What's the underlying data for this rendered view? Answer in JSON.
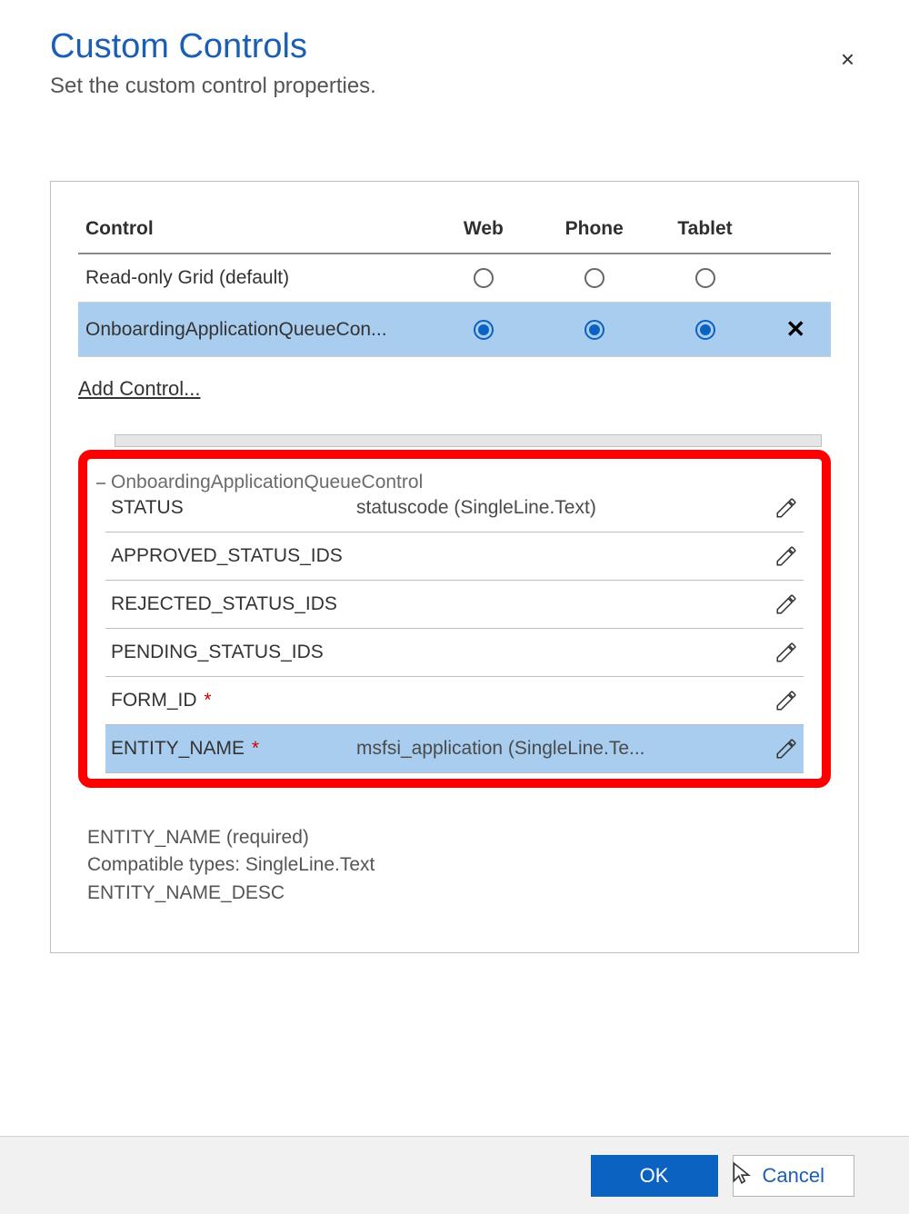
{
  "dialog": {
    "title": "Custom Controls",
    "subtitle": "Set the custom control properties.",
    "close_icon": "×"
  },
  "controls_table": {
    "headers": {
      "control": "Control",
      "web": "Web",
      "phone": "Phone",
      "tablet": "Tablet"
    },
    "rows": [
      {
        "name": "Read-only Grid (default)",
        "web": false,
        "phone": false,
        "tablet": false,
        "deletable": false,
        "selected": false
      },
      {
        "name": "OnboardingApplicationQueueCon...",
        "web": true,
        "phone": true,
        "tablet": true,
        "deletable": true,
        "selected": true
      }
    ],
    "add_link": "Add Control..."
  },
  "properties": {
    "legend": "OnboardingApplicationQueueControl",
    "rows": [
      {
        "label": "STATUS",
        "required": false,
        "value": "statuscode (SingleLine.Text)",
        "selected": false
      },
      {
        "label": "APPROVED_STATUS_IDS",
        "required": false,
        "value": "",
        "selected": false
      },
      {
        "label": "REJECTED_STATUS_IDS",
        "required": false,
        "value": "",
        "selected": false
      },
      {
        "label": "PENDING_STATUS_IDS",
        "required": false,
        "value": "",
        "selected": false
      },
      {
        "label": "FORM_ID",
        "required": true,
        "value": "",
        "selected": false
      },
      {
        "label": "ENTITY_NAME",
        "required": true,
        "value": "msfsi_application (SingleLine.Te...",
        "selected": true
      }
    ]
  },
  "description": {
    "line1": "ENTITY_NAME (required)",
    "line2": "Compatible types: SingleLine.Text",
    "line3": "ENTITY_NAME_DESC"
  },
  "footer": {
    "ok": "OK",
    "cancel": "Cancel"
  },
  "icons": {
    "pencil": "pencil-icon",
    "delete_x": "✕",
    "cursor": "cursor-icon"
  }
}
